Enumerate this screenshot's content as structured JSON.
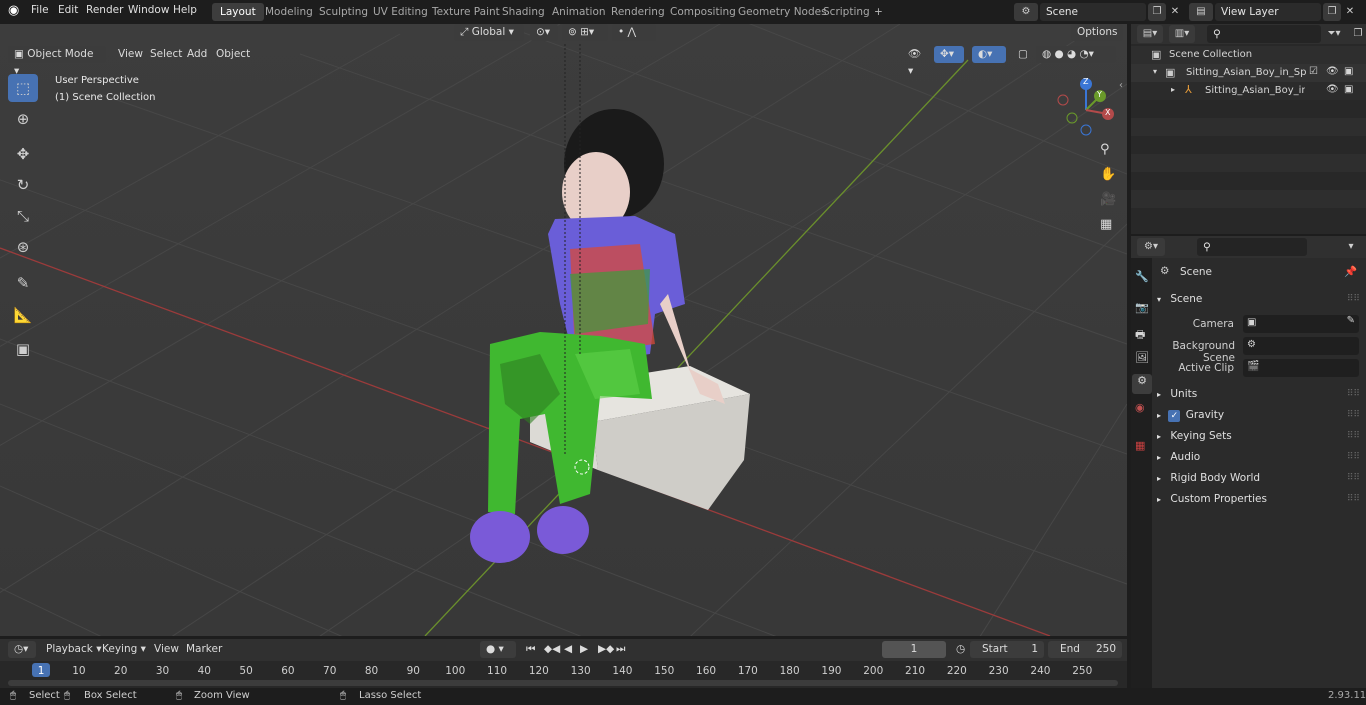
{
  "topbar": {
    "menus": [
      "File",
      "Edit",
      "Render",
      "Window",
      "Help"
    ],
    "workspaces": [
      "Layout",
      "Modeling",
      "Sculpting",
      "UV Editing",
      "Texture Paint",
      "Shading",
      "Animation",
      "Rendering",
      "Compositing",
      "Geometry Nodes",
      "Scripting"
    ],
    "active_workspace": "Layout",
    "add_tab": "+",
    "scene": "Scene",
    "view_layer": "View Layer"
  },
  "viewport_header": {
    "mode": "Object Mode",
    "menus": [
      "View",
      "Select",
      "Add",
      "Object"
    ],
    "transform_orientation": "Global",
    "options": "Options"
  },
  "viewport": {
    "perspective": "User Perspective",
    "collection": "(1) Scene Collection",
    "gizmo_axes": [
      "Z",
      "Y",
      "X"
    ]
  },
  "outliner": {
    "root": "Scene Collection",
    "items": [
      "Sitting_Asian_Boy_in_Spiderm",
      "Sitting_Asian_Boy_in_Spi"
    ]
  },
  "properties": {
    "context": "Scene",
    "section": "Scene",
    "fields": [
      {
        "label": "Camera"
      },
      {
        "label": "Background Scene"
      },
      {
        "label": "Active Clip"
      }
    ],
    "panels": [
      "Units",
      "Gravity",
      "Keying Sets",
      "Audio",
      "Rigid Body World",
      "Custom Properties"
    ],
    "gravity_checked": true
  },
  "timeline": {
    "menus": [
      "Playback",
      "Keying",
      "View",
      "Marker"
    ],
    "current_frame": "1",
    "start_label": "Start",
    "start": "1",
    "end_label": "End",
    "end": "250",
    "ticks": [
      "1",
      "10",
      "20",
      "30",
      "40",
      "50",
      "60",
      "70",
      "80",
      "90",
      "100",
      "110",
      "120",
      "130",
      "140",
      "150",
      "160",
      "170",
      "180",
      "190",
      "200",
      "210",
      "220",
      "230",
      "240",
      "250"
    ]
  },
  "statusbar": {
    "select": "Select",
    "box_select": "Box Select",
    "zoom_view": "Zoom View",
    "lasso_select": "Lasso Select",
    "version": "2.93.11"
  },
  "colors": {
    "accent": "#4772b3",
    "x_axis": "#b34a4a",
    "y_axis": "#6a9a2a",
    "z_axis": "#3a76d6"
  }
}
